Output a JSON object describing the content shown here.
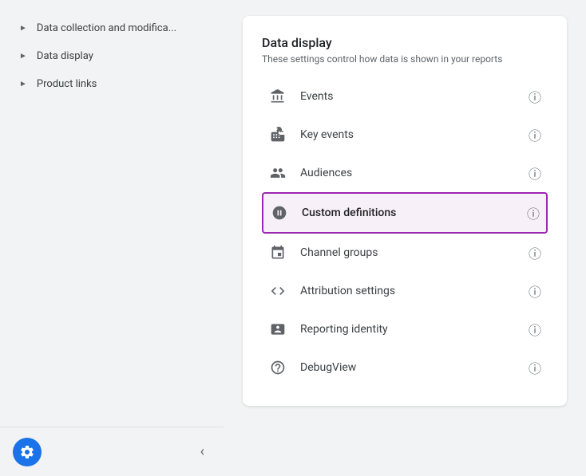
{
  "sidebar": {
    "items": [
      {
        "label": "Data collection and modifica...",
        "id": "data-collection"
      },
      {
        "label": "Data display",
        "id": "data-display"
      },
      {
        "label": "Product links",
        "id": "product-links"
      }
    ],
    "gear_label": "⚙",
    "collapse_label": "‹"
  },
  "card": {
    "title": "Data display",
    "subtitle": "These settings control how data is shown in your reports",
    "menu_items": [
      {
        "id": "events",
        "label": "Events",
        "icon": "events"
      },
      {
        "id": "key-events",
        "label": "Key events",
        "icon": "key-events"
      },
      {
        "id": "audiences",
        "label": "Audiences",
        "icon": "audiences"
      },
      {
        "id": "custom-definitions",
        "label": "Custom definitions",
        "icon": "custom-definitions",
        "active": true
      },
      {
        "id": "channel-groups",
        "label": "Channel groups",
        "icon": "channel-groups"
      },
      {
        "id": "attribution-settings",
        "label": "Attribution settings",
        "icon": "attribution"
      },
      {
        "id": "reporting-identity",
        "label": "Reporting identity",
        "icon": "reporting"
      },
      {
        "id": "debugview",
        "label": "DebugView",
        "icon": "debug"
      }
    ]
  }
}
